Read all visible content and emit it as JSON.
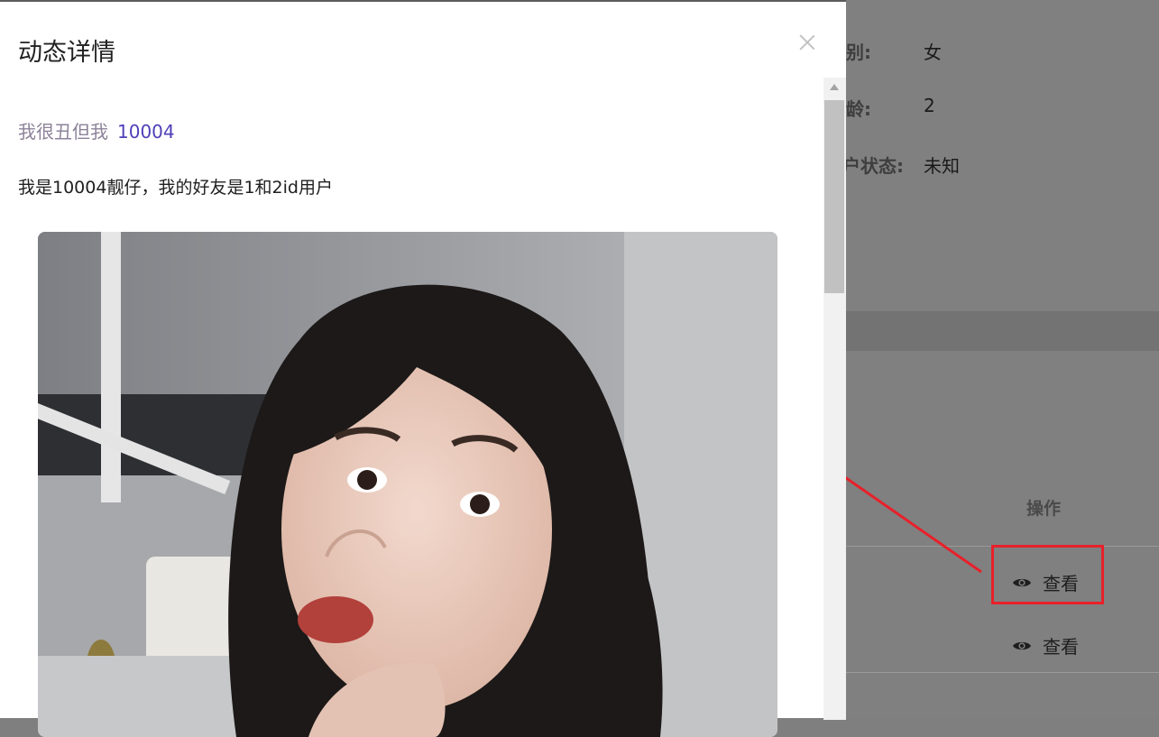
{
  "background": {
    "fields": [
      {
        "label": "别:",
        "value": "女"
      },
      {
        "label": "龄:",
        "value": "2"
      },
      {
        "label": "户状态:",
        "value": "未知"
      }
    ],
    "table": {
      "action_header": "操作",
      "rows": [
        {
          "action_label": "查看"
        },
        {
          "action_label": "查看"
        }
      ]
    }
  },
  "modal": {
    "title": "动态详情",
    "user_nickname": "我很丑但我",
    "user_id": "10004",
    "content_text": "我是10004靓仔，我的好友是1和2id用户"
  },
  "icons": {
    "close": "close-icon",
    "view": "eye-icon"
  },
  "colors": {
    "annotation": "#e8202a",
    "user_id": "#4e3fb8",
    "nickname": "#8d8399"
  }
}
